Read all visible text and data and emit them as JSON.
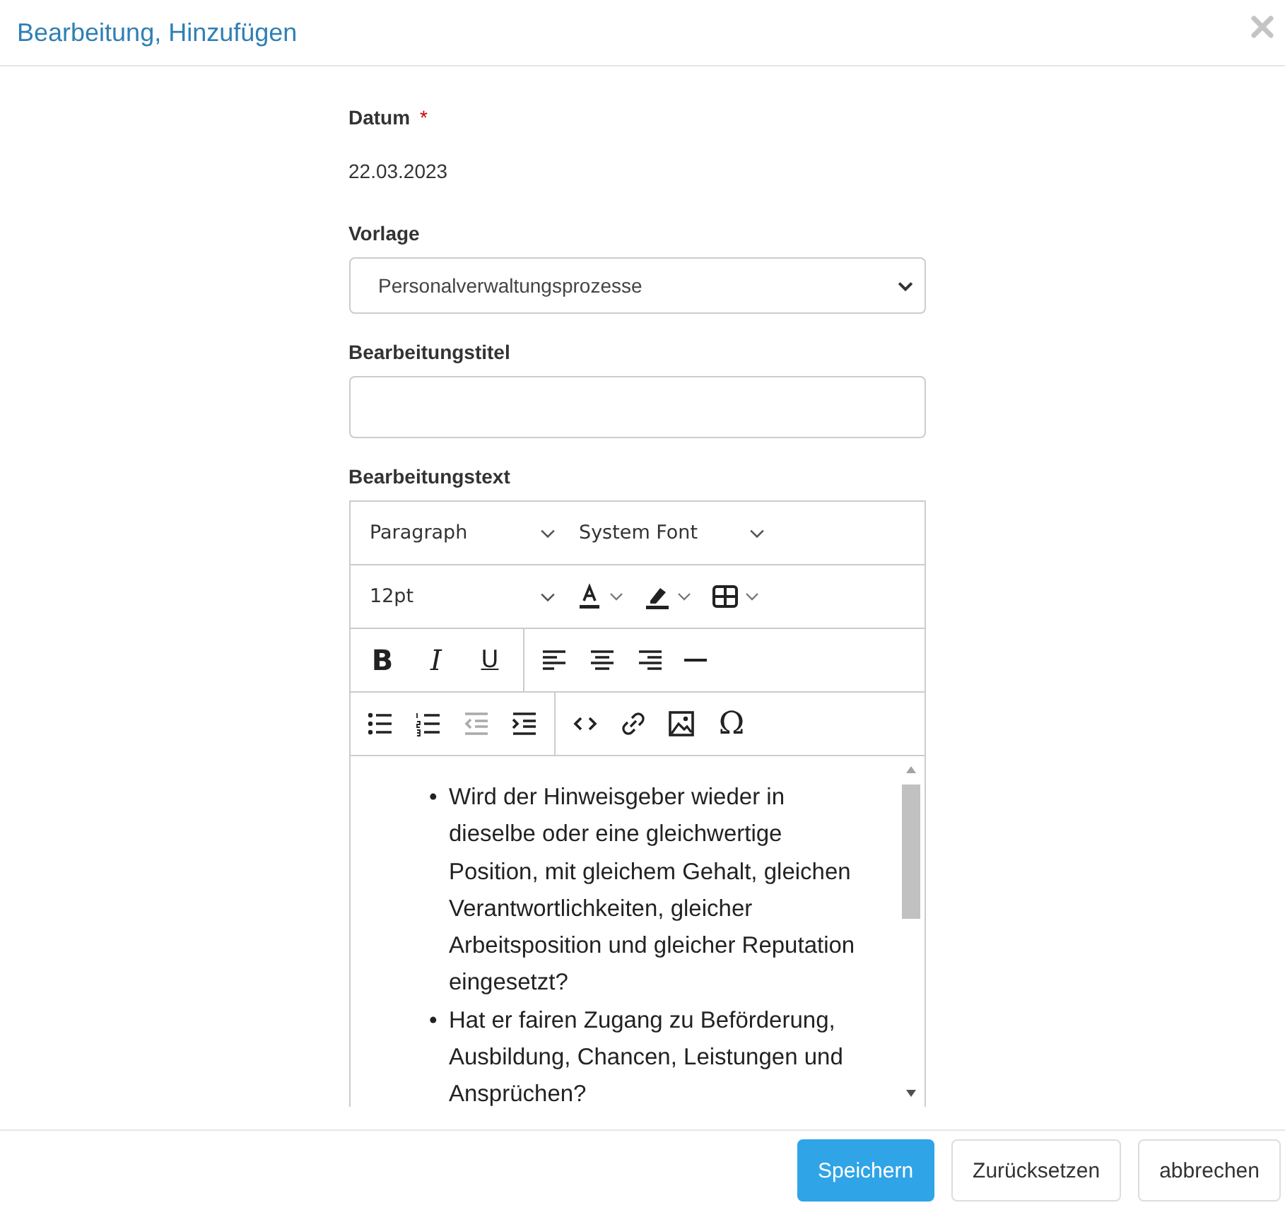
{
  "dialog": {
    "title": "Bearbeitung, Hinzufügen"
  },
  "fields": [
    {
      "kind": "static",
      "label": "Datum",
      "required_mark": "*",
      "value": "22.03.2023"
    },
    {
      "kind": "select",
      "label": "Vorlage",
      "value": "Personalverwaltungsprozesse"
    },
    {
      "kind": "input",
      "label": "Bearbeitungstitel"
    },
    {
      "kind": "editor",
      "label": "Bearbeitungstext"
    }
  ],
  "editor": {
    "toolbar": [
      [
        {
          "items": [
            {
              "kind": "dropdown",
              "label": "Paragraph"
            },
            {
              "kind": "dropdown",
              "label": "System Font"
            }
          ]
        }
      ],
      [
        {
          "items": [
            {
              "kind": "dropdown",
              "label": "12pt"
            },
            {
              "kind": "text_color"
            },
            {
              "kind": "highlight"
            },
            {
              "kind": "table"
            }
          ]
        }
      ],
      [
        {
          "items": [
            {
              "kind": "bold",
              "text": "B"
            },
            {
              "kind": "italic",
              "text": "I"
            },
            {
              "kind": "underline",
              "text": "U"
            }
          ]
        },
        {
          "items": [
            {
              "kind": "align_left"
            },
            {
              "kind": "align_center"
            },
            {
              "kind": "align_right"
            },
            {
              "kind": "hr"
            }
          ]
        }
      ],
      [
        {
          "items": [
            {
              "kind": "bullet_list"
            },
            {
              "kind": "numbered_list"
            },
            {
              "kind": "outdent",
              "disabled": true
            },
            {
              "kind": "indent",
              "disabled": false
            }
          ]
        },
        {
          "items": [
            {
              "kind": "code"
            },
            {
              "kind": "link"
            },
            {
              "kind": "image"
            },
            {
              "kind": "symbol",
              "text": "Ω"
            }
          ]
        }
      ]
    ],
    "content": [
      {
        "bullet": "•",
        "text": "Wird der Hinweisgeber wieder in dieselbe oder eine gleichwertige Position, mit gleichem Gehalt, gleichen Verantwortlichkeiten, gleicher Arbeitsposition und gleicher Reputation eingesetzt?"
      },
      {
        "bullet": "•",
        "text": "Hat er fairen Zugang zu Beförderung, Ausbildung, Chancen, Leistungen und Ansprüchen?"
      }
    ]
  },
  "buttons": [
    {
      "label": "Speichern",
      "primary": true
    },
    {
      "label": "Zurücksetzen",
      "primary": false
    },
    {
      "label": "abbrechen",
      "primary": false
    }
  ]
}
